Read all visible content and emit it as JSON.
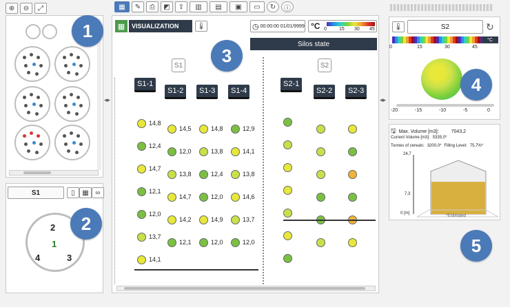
{
  "left_panel_top": {
    "small_silos": 2,
    "silo_dot_groups": 6
  },
  "left_panel_bottom": {
    "silo_selector": "S1",
    "cables": [
      {
        "label": "2"
      },
      {
        "label": "1"
      },
      {
        "label": "4"
      },
      {
        "label": "3"
      }
    ]
  },
  "badges": [
    "1",
    "2",
    "3",
    "4",
    "5"
  ],
  "visualization": {
    "title": "VISUALIZATION",
    "datetime": "00:00:00 01/01/9999",
    "temp_unit": "°C",
    "legend_ticks": [
      "0",
      "15",
      "30",
      "45"
    ],
    "silos_state_label": "Silos state"
  },
  "silos": [
    {
      "name": "S1",
      "columns": [
        {
          "label": "S1-1",
          "sensors": [
            {
              "v": "14,8",
              "c": "#e8e83a"
            },
            {
              "v": "12,4",
              "c": "#7bc043"
            },
            {
              "v": "14,7",
              "c": "#e8e83a"
            },
            {
              "v": "12,1",
              "c": "#7bc043"
            },
            {
              "v": "12,0",
              "c": "#7bc043"
            },
            {
              "v": "13,7",
              "c": "#c8e04a"
            },
            {
              "v": "14,1",
              "c": "#e8e83a"
            }
          ]
        },
        {
          "label": "S1-2",
          "sensors": [
            {
              "v": "14,5",
              "c": "#e8e83a"
            },
            {
              "v": "12,0",
              "c": "#7bc043"
            },
            {
              "v": "13,8",
              "c": "#c8e04a"
            },
            {
              "v": "14,7",
              "c": "#e8e83a"
            },
            {
              "v": "14,2",
              "c": "#e8e83a"
            },
            {
              "v": "12,1",
              "c": "#7bc043"
            }
          ]
        },
        {
          "label": "S1-3",
          "sensors": [
            {
              "v": "14,8",
              "c": "#e8e83a"
            },
            {
              "v": "13,8",
              "c": "#c8e04a"
            },
            {
              "v": "12,4",
              "c": "#7bc043"
            },
            {
              "v": "12,0",
              "c": "#7bc043"
            },
            {
              "v": "14,9",
              "c": "#e8e83a"
            },
            {
              "v": "12,0",
              "c": "#7bc043"
            }
          ]
        },
        {
          "label": "S1-4",
          "sensors": [
            {
              "v": "12,9",
              "c": "#7bc043"
            },
            {
              "v": "14,1",
              "c": "#e8e83a"
            },
            {
              "v": "13,8",
              "c": "#c8e04a"
            },
            {
              "v": "14,6",
              "c": "#e8e83a"
            },
            {
              "v": "13,7",
              "c": "#c8e04a"
            },
            {
              "v": "12,0",
              "c": "#7bc043"
            }
          ]
        }
      ]
    },
    {
      "name": "S2",
      "columns": [
        {
          "label": "S2-1",
          "sensors": [
            {
              "v": "",
              "c": "#7bc043"
            },
            {
              "v": "",
              "c": "#c8e04a"
            },
            {
              "v": "",
              "c": "#e8e83a"
            },
            {
              "v": "",
              "c": "#e8e83a"
            },
            {
              "v": "",
              "c": "#c8e04a"
            },
            {
              "v": "",
              "c": "#e8e83a"
            },
            {
              "v": "",
              "c": "#7bc043"
            }
          ]
        },
        {
          "label": "S2-2",
          "sensors": [
            {
              "v": "",
              "c": "#c8e04a"
            },
            {
              "v": "",
              "c": "#c8e04a"
            },
            {
              "v": "",
              "c": "#c8e04a"
            },
            {
              "v": "",
              "c": "#7bc043"
            },
            {
              "v": "",
              "c": "#7bc043"
            },
            {
              "v": "",
              "c": "#c8e04a"
            }
          ]
        },
        {
          "label": "S2-3",
          "sensors": [
            {
              "v": "",
              "c": "#e8e83a"
            },
            {
              "v": "",
              "c": "#7bc043"
            },
            {
              "v": "",
              "c": "#f0b23a"
            },
            {
              "v": "",
              "c": "#7bc043"
            },
            {
              "v": "",
              "c": "#f0b23a"
            },
            {
              "v": "",
              "c": "#e8e83a"
            }
          ]
        }
      ]
    }
  ],
  "right_top": {
    "silo": "S2",
    "scale_ticks": [
      "0",
      "15",
      "30",
      "45"
    ],
    "unit": "°C",
    "slider_ticks": [
      "-20",
      "-15",
      "-10",
      "-5",
      "0"
    ]
  },
  "right_bottom": {
    "max_volume_label": "Max. Volume [m3]:",
    "max_volume_value": "7043,2",
    "current_volume_label": "Current Volume [m3]:",
    "current_volume_value": "5335,0*",
    "tonnes_label": "Tonnes of cereals:",
    "tonnes_value": "3200,0*",
    "filling_label": "Filling Level:",
    "filling_value": "75,7%*",
    "axis_top": "24,7",
    "axis_mid": "7,3",
    "axis_bottom": "0 [m]",
    "estimated": "*Estimated",
    "filling_fraction": 0.757
  }
}
